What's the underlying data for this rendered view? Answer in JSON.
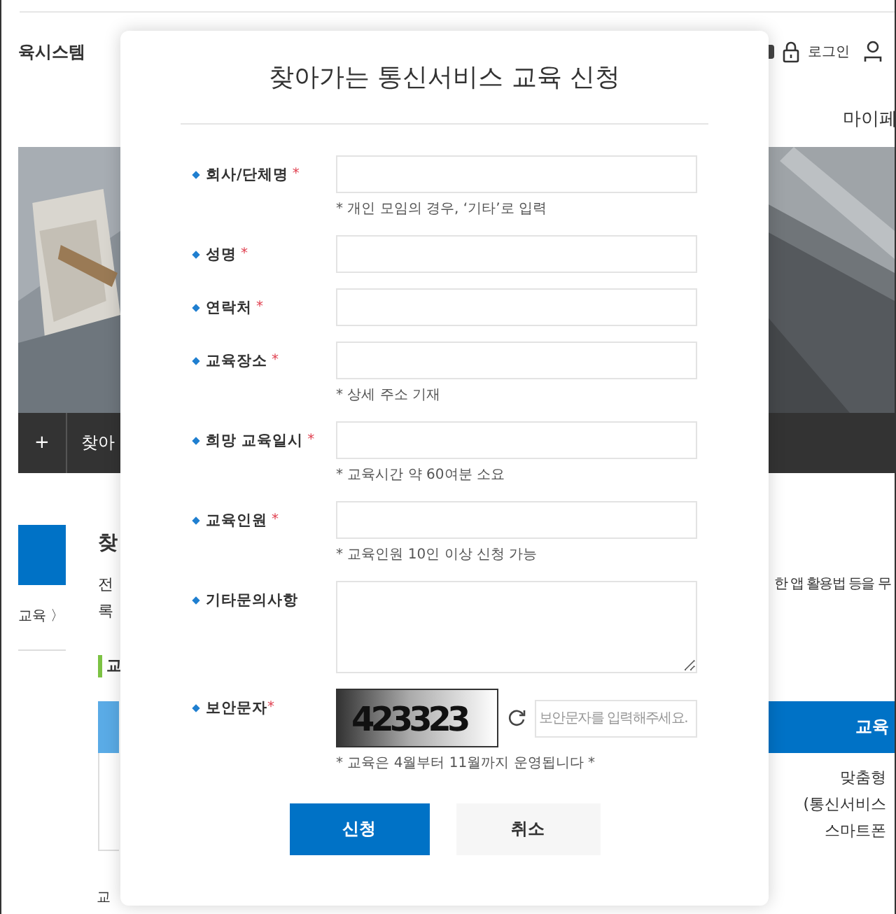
{
  "page": {
    "brand": "육시스템",
    "login": "로그인",
    "mypage": "마이페",
    "nav": {
      "plus": "+",
      "item": "찾아"
    },
    "sidebar": {
      "item": "교육 〉"
    },
    "content": {
      "title": "찾",
      "desc_left": [
        "전",
        "록"
      ],
      "desc_right": "한 앱 활용법 등을 무",
      "section": "교",
      "table_header": "교육",
      "table_lines": [
        "맞춤형",
        "(통신서비스",
        "스마트폰"
      ],
      "footer": "교"
    }
  },
  "modal": {
    "title": "찾아가는 통신서비스 교육 신청",
    "fields": [
      {
        "kind": "text",
        "label": "회사/단체명",
        "mark": "*",
        "help": "* 개인 모임의 경우, ‘기타’로 입력"
      },
      {
        "kind": "text",
        "label": "성명",
        "mark": "*"
      },
      {
        "kind": "text",
        "label": "연락처",
        "mark": "*"
      },
      {
        "kind": "text",
        "label": "교육장소",
        "mark": "*",
        "help": "* 상세 주소 기재"
      },
      {
        "kind": "text",
        "label": "희망 교육일시",
        "mark": "*",
        "help": "* 교육시간 약 60여분 소요"
      },
      {
        "kind": "text",
        "label": "교육인원",
        "mark": "*",
        "help": "* 교육인원 10인 이상 신청 가능"
      },
      {
        "kind": "textarea",
        "label": "기타문의사항"
      },
      {
        "kind": "captcha",
        "label": "보안문자",
        "mark": "*",
        "code": "423323",
        "placeholder": "보안문자를 입력해주세요.",
        "help": "* 교육은 4월부터 11월까지 운영됩니다 *"
      }
    ],
    "buttons": [
      {
        "kind": "primary",
        "label": "신청"
      },
      {
        "kind": "secondary",
        "label": "취소"
      }
    ]
  }
}
